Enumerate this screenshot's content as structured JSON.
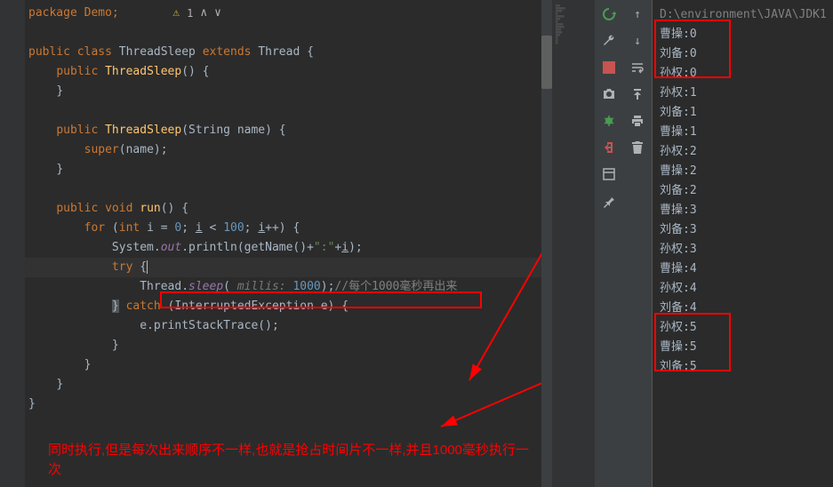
{
  "topbar": {
    "warning_count": "1"
  },
  "code": {
    "l1": "package Demo;",
    "l3_public": "public",
    "l3_class": "class",
    "l3_name": "ThreadSleep",
    "l3_extends": "extends",
    "l3_parent": "Thread",
    "l3_open": " {",
    "l4_public": "public",
    "l4_name": "ThreadSleep",
    "l4_open": "() {",
    "l5": "}",
    "l7_public": "public",
    "l7_name": "ThreadSleep",
    "l7_params": "(String name) {",
    "l8_super": "super",
    "l8_rest": "(name);",
    "l9": "}",
    "l11_public": "public",
    "l11_void": "void",
    "l11_name": "run",
    "l11_open": "() {",
    "l12_for": "for",
    "l12_open": " (",
    "l12_int": "int",
    "l12_var": " i",
    "l12_eq": " = ",
    "l12_zero": "0",
    "l12_cond": "; ",
    "l12_var2": "i",
    "l12_lt": " < ",
    "l12_hundred": "100",
    "l12_inc": "; ",
    "l12_var3": "i",
    "l12_pp": "++) {",
    "l13_sys": "System.",
    "l13_out": "out",
    "l13_print": ".println(getName()+",
    "l13_colon": "\":\"",
    "l13_plus": "+",
    "l13_i": "i",
    "l13_end": ");",
    "l14_try": "try",
    "l14_brace": " {",
    "l15_thread": "Thread.",
    "l15_sleep": "sleep",
    "l15_open": "( ",
    "l15_hint": "millis:",
    "l15_val": " 1000",
    "l15_close": ");",
    "l15_comment": "//每个1000毫秒再出来",
    "l16_brace": "}",
    "l16_catch": " catch ",
    "l16_params": "(InterruptedException e) {",
    "l17": "e.printStackTrace();",
    "l18": "}",
    "l19": "}",
    "l20": "}",
    "l21": "}"
  },
  "annotation": {
    "text": "同时执行,但是每次出来顺序不一样,也就是抢占时间片不一样,并且1000毫秒执行一次"
  },
  "console": {
    "header": "D:\\environment\\JAVA\\JDK1.",
    "lines": [
      "曹操:0",
      "刘备:0",
      "孙权:0",
      "孙权:1",
      "刘备:1",
      "曹操:1",
      "孙权:2",
      "曹操:2",
      "刘备:2",
      "曹操:3",
      "刘备:3",
      "孙权:3",
      "曹操:4",
      "孙权:4",
      "刘备:4",
      "孙权:5",
      "曹操:5",
      "刘备:5"
    ]
  }
}
